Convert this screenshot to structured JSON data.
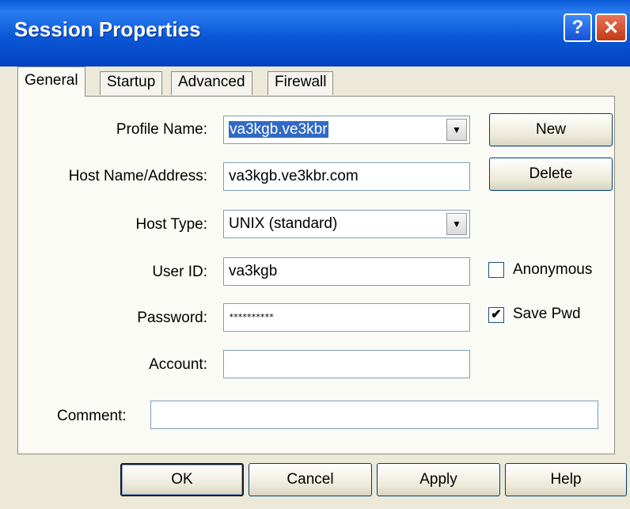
{
  "window": {
    "title": "Session Properties",
    "help_button": "?",
    "close_button": "✕"
  },
  "tabs": [
    {
      "label": "General",
      "active": true
    },
    {
      "label": "Startup",
      "active": false
    },
    {
      "label": "Advanced",
      "active": false
    },
    {
      "label": "Firewall",
      "active": false
    }
  ],
  "form": {
    "profile_name": {
      "label": "Profile Name:",
      "value": "va3kgb.ve3kbr"
    },
    "host_name": {
      "label": "Host Name/Address:",
      "value": "va3kgb.ve3kbr.com"
    },
    "host_type": {
      "label": "Host Type:",
      "value": "UNIX (standard)"
    },
    "user_id": {
      "label": "User ID:",
      "value": "va3kgb"
    },
    "password": {
      "label": "Password:",
      "value": "**********"
    },
    "account": {
      "label": "Account:",
      "value": ""
    },
    "comment": {
      "label": "Comment:",
      "value": ""
    }
  },
  "side_buttons": {
    "new": "New",
    "delete": "Delete"
  },
  "checkboxes": {
    "anonymous": {
      "label": "Anonymous",
      "checked": false,
      "mark": ""
    },
    "save_pwd": {
      "label": "Save Pwd",
      "checked": true,
      "mark": "✔"
    }
  },
  "dialog_buttons": {
    "ok": "OK",
    "cancel": "Cancel",
    "apply": "Apply",
    "help": "Help"
  },
  "dropdown_glyph": "▼"
}
